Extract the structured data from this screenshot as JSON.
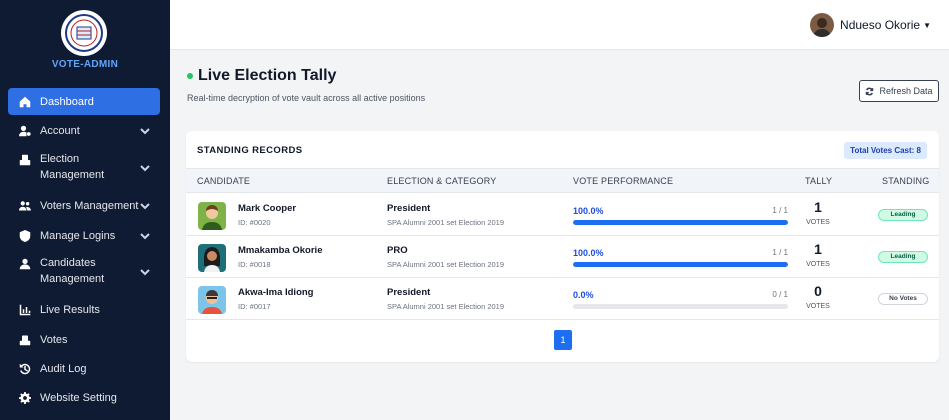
{
  "brand": {
    "name": "VOTE-ADMIN"
  },
  "sidebar": {
    "items": [
      {
        "label": "Dashboard",
        "icon": "home-icon",
        "active": true,
        "expandable": false
      },
      {
        "label": "Account",
        "icon": "user-gear-icon",
        "active": false,
        "expandable": true
      },
      {
        "label": "Election Management",
        "icon": "ballot-box-icon",
        "active": false,
        "expandable": true
      },
      {
        "label": "Voters Management",
        "icon": "users-icon",
        "active": false,
        "expandable": true
      },
      {
        "label": "Manage Logins",
        "icon": "shield-icon",
        "active": false,
        "expandable": true
      },
      {
        "label": "Candidates Management",
        "icon": "user-icon",
        "active": false,
        "expandable": true
      },
      {
        "label": "Live Results",
        "icon": "chart-icon",
        "active": false,
        "expandable": false
      },
      {
        "label": "Votes",
        "icon": "votes-icon",
        "active": false,
        "expandable": false
      },
      {
        "label": "Audit Log",
        "icon": "history-icon",
        "active": false,
        "expandable": false
      },
      {
        "label": "Website Setting",
        "icon": "gear-icon",
        "active": false,
        "expandable": false
      }
    ]
  },
  "topbar": {
    "user_name": "Ndueso Okorie"
  },
  "page": {
    "title": "Live Election Tally",
    "subtitle": "Real-time decryption of vote vault across all active positions",
    "refresh_label": "Refresh Data"
  },
  "records": {
    "title": "STANDING RECORDS",
    "total_badge": "Total Votes Cast: 8",
    "headers": {
      "candidate": "CANDIDATE",
      "election": "ELECTION & CATEGORY",
      "performance": "VOTE PERFORMANCE",
      "tally": "TALLY",
      "standing": "STANDING"
    },
    "rows": [
      {
        "name": "Mark Cooper",
        "id": "ID: #0020",
        "position": "President",
        "election": "SPA Alumni 2001 set Election 2019",
        "percent": "100.0%",
        "fraction": "1 / 1",
        "progress": 1.0,
        "tally": "1",
        "tally_label": "VOTES",
        "standing": "Leading"
      },
      {
        "name": "Mmakamba Okorie",
        "id": "ID: #0018",
        "position": "PRO",
        "election": "SPA Alumni 2001 set Election 2019",
        "percent": "100.0%",
        "fraction": "1 / 1",
        "progress": 1.0,
        "tally": "1",
        "tally_label": "VOTES",
        "standing": "Leading"
      },
      {
        "name": "Akwa-Ima Idiong",
        "id": "ID: #0017",
        "position": "President",
        "election": "SPA Alumni 2001 set Election 2019",
        "percent": "0.0%",
        "fraction": "0 / 1",
        "progress": 0.0,
        "tally": "0",
        "tally_label": "VOTES",
        "standing": "No Votes"
      }
    ],
    "page_number": "1"
  },
  "colors": {
    "sidebar_bg": "#0f1b33",
    "accent": "#2f6fe4",
    "live_dot": "#22c55e"
  }
}
